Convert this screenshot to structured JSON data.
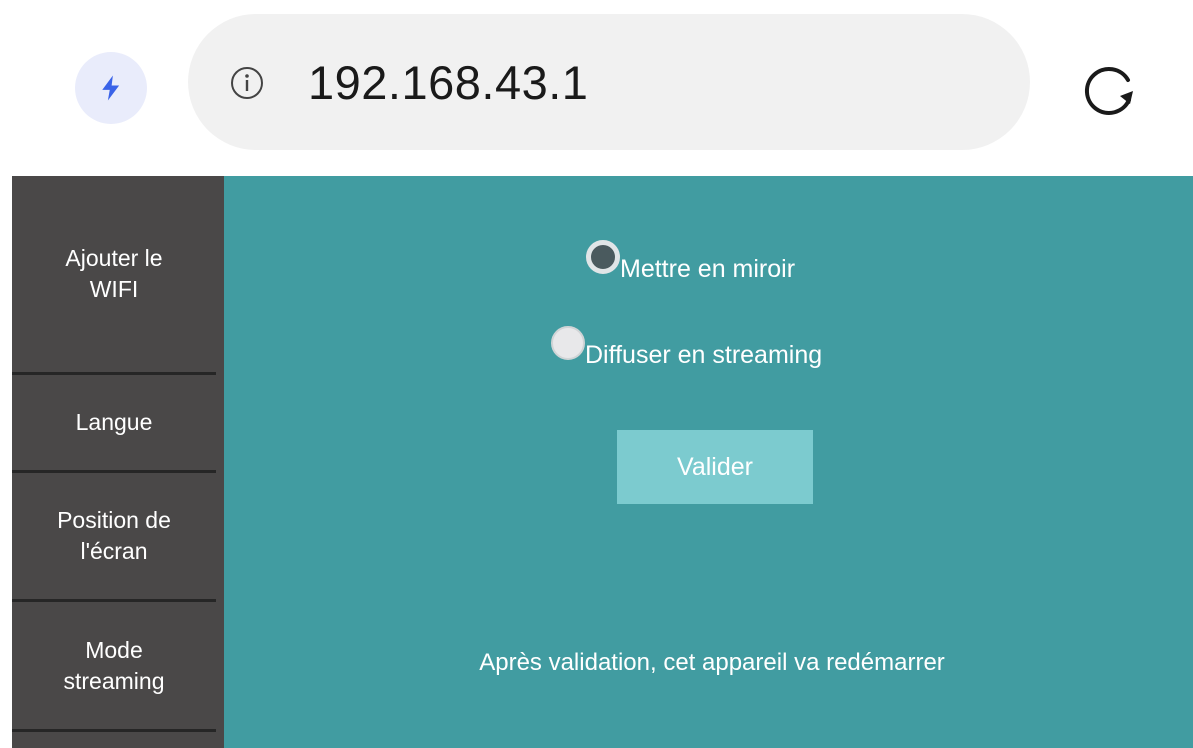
{
  "browser": {
    "url": "192.168.43.1",
    "accent_color": "#3a63e8",
    "icons": {
      "bolt": "lightning-bolt-icon",
      "info": "info-icon",
      "reload": "reload-icon"
    }
  },
  "sidebar": {
    "items": [
      {
        "label": "Ajouter le\nWIFI"
      },
      {
        "label": "Langue"
      },
      {
        "label": "Position de\nl'écran"
      },
      {
        "label": "Mode\nstreaming"
      }
    ]
  },
  "main": {
    "background_color": "#419ca1",
    "options": [
      {
        "label": "Mettre en miroir",
        "checked": true
      },
      {
        "label": "Diffuser en streaming",
        "checked": false
      }
    ],
    "validate_label": "Valider",
    "notice": "Après validation, cet appareil va redémarrer"
  }
}
